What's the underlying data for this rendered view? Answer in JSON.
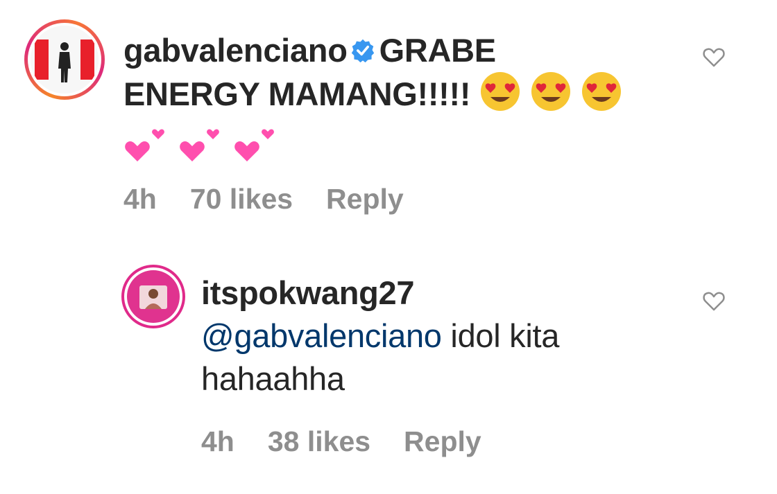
{
  "comments": [
    {
      "username": "gabvalenciano",
      "verified": true,
      "text_line1": "GRABE",
      "text_line2": "ENERGY MAMANG!!!!!",
      "emojis": [
        "heart-eyes-face",
        "heart-eyes-face",
        "heart-eyes-face",
        "two-hearts",
        "two-hearts",
        "two-hearts"
      ],
      "time": "4h",
      "likes": "70 likes",
      "reply_label": "Reply"
    },
    {
      "username": "itspokwang27",
      "verified": false,
      "mention": "@gabvalenciano",
      "text_line1": "idol kita",
      "text_line2": "hahaahha",
      "time": "4h",
      "likes": "38 likes",
      "reply_label": "Reply"
    }
  ],
  "colors": {
    "text": "#262626",
    "muted": "#8e8e8e",
    "mention": "#00376b",
    "verified": "#3897f0",
    "heart_outline": "#8e8e8e"
  }
}
